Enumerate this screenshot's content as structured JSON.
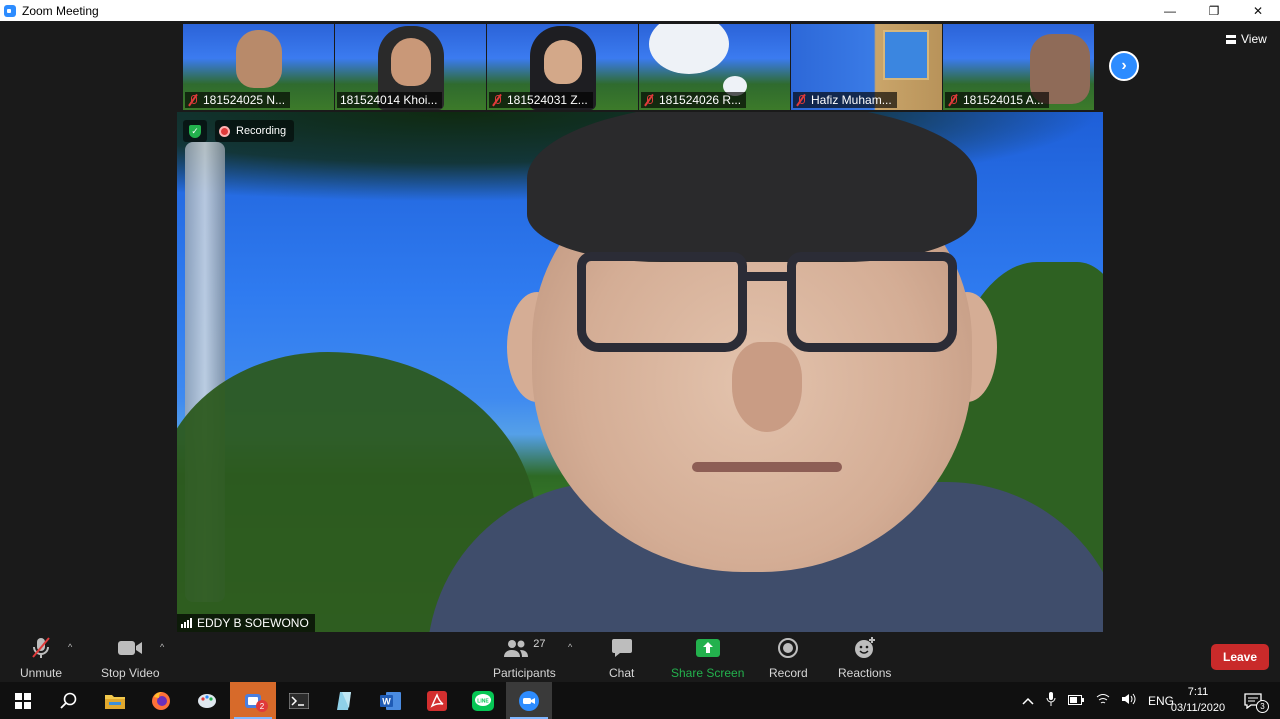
{
  "window": {
    "title": "Zoom Meeting",
    "controls": {
      "minimize": "—",
      "restore": "❐",
      "close": "✕"
    }
  },
  "gallery": {
    "participants": [
      {
        "name": "181524025 N...",
        "muted": true
      },
      {
        "name": "181524014 Khoi...",
        "muted": false
      },
      {
        "name": "181524031 Z...",
        "muted": true
      },
      {
        "name": "181524026 R...",
        "muted": true
      },
      {
        "name": "Hafiz Muham...",
        "muted": true
      },
      {
        "name": "181524015 A...",
        "muted": true
      }
    ],
    "next_icon": "chevron-right-icon",
    "view_label": "View"
  },
  "main": {
    "recording_label": "Recording",
    "speaker_name": "EDDY B SOEWONO"
  },
  "toolbar": {
    "unmute": "Unmute",
    "stop_video": "Stop Video",
    "participants": "Participants",
    "participants_count": "27",
    "chat": "Chat",
    "share_screen": "Share Screen",
    "record": "Record",
    "reactions": "Reactions",
    "leave": "Leave",
    "caret": "^"
  },
  "taskbar": {
    "language": "ENG",
    "time": "7:11",
    "date": "03/11/2020",
    "notifications_count": "3",
    "teams_badge": "2"
  },
  "colors": {
    "zoom_blue": "#2d8cff",
    "share_green": "#23b14d",
    "leave_red": "#c92a2a",
    "muted_red": "#e03a3a"
  }
}
